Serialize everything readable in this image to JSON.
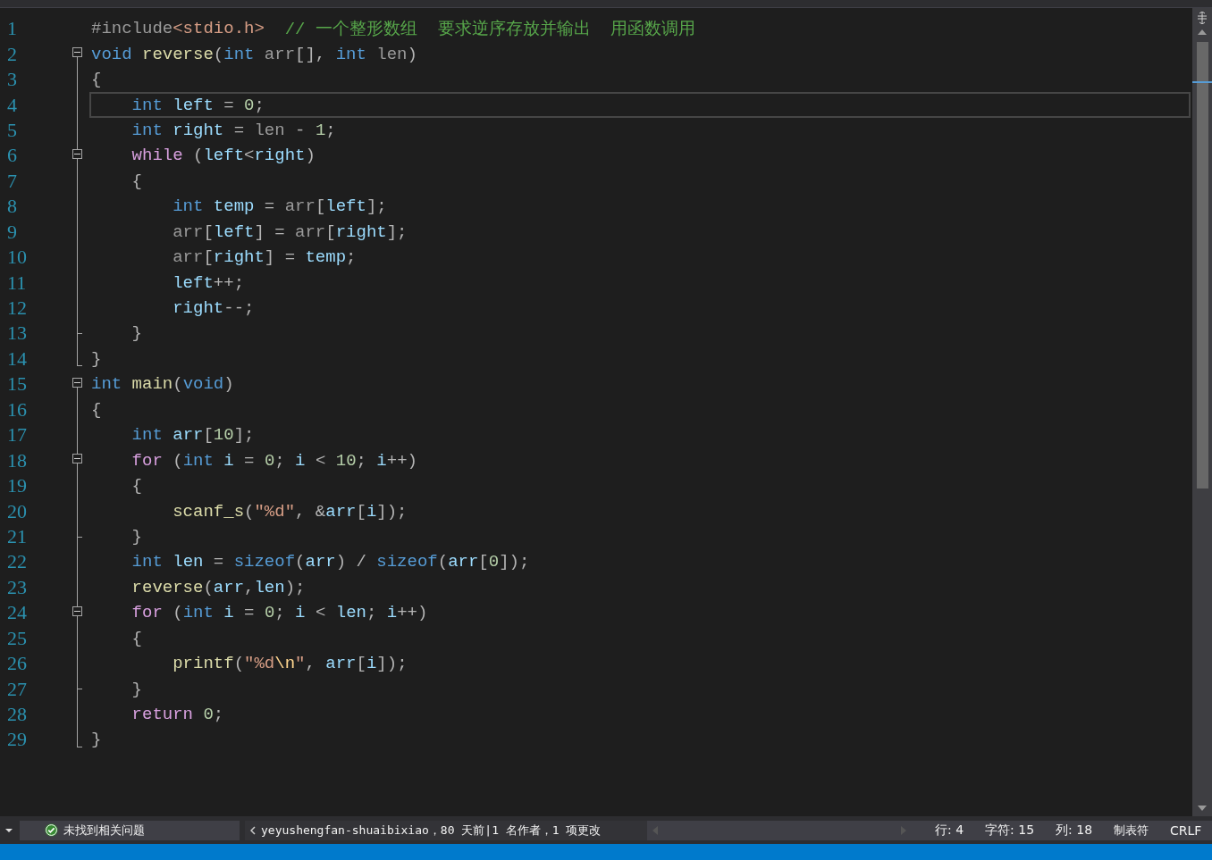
{
  "editor": {
    "lines": [
      {
        "number": "1",
        "kind": "none",
        "current": false,
        "tokens": [
          {
            "kind": "preproc",
            "text": "#include"
          },
          {
            "kind": "string",
            "text": "<stdio.h>"
          },
          {
            "kind": "comment",
            "text": "  // 一个整形数组  要求逆序存放并输出  用函数调用"
          }
        ]
      },
      {
        "number": "2",
        "kind": "open",
        "current": false,
        "tokens": [
          {
            "kind": "type",
            "text": "void"
          },
          {
            "kind": "func",
            "text": " reverse"
          },
          {
            "kind": "plain",
            "text": "("
          },
          {
            "kind": "type",
            "text": "int"
          },
          {
            "kind": "param",
            "text": " arr"
          },
          {
            "kind": "plain",
            "text": "[], "
          },
          {
            "kind": "type",
            "text": "int"
          },
          {
            "kind": "param",
            "text": " len"
          },
          {
            "kind": "plain",
            "text": ")"
          }
        ]
      },
      {
        "number": "3",
        "kind": "line",
        "current": false,
        "tokens": [
          {
            "kind": "plain",
            "text": "{"
          }
        ]
      },
      {
        "number": "4",
        "kind": "line",
        "current": true,
        "tokens": [
          {
            "kind": "type",
            "text": "    int"
          },
          {
            "kind": "local",
            "text": " left"
          },
          {
            "kind": "plain",
            "text": " = "
          },
          {
            "kind": "number",
            "text": "0"
          },
          {
            "kind": "plain",
            "text": ";"
          }
        ]
      },
      {
        "number": "5",
        "kind": "line",
        "current": false,
        "tokens": [
          {
            "kind": "type",
            "text": "    int"
          },
          {
            "kind": "local",
            "text": " right"
          },
          {
            "kind": "plain",
            "text": " = "
          },
          {
            "kind": "param",
            "text": "len"
          },
          {
            "kind": "plain",
            "text": " - "
          },
          {
            "kind": "number",
            "text": "1"
          },
          {
            "kind": "plain",
            "text": ";"
          }
        ]
      },
      {
        "number": "6",
        "kind": "open",
        "current": false,
        "tokens": [
          {
            "kind": "control",
            "text": "    while"
          },
          {
            "kind": "plain",
            "text": " ("
          },
          {
            "kind": "local",
            "text": "left"
          },
          {
            "kind": "plain",
            "text": "<"
          },
          {
            "kind": "local",
            "text": "right"
          },
          {
            "kind": "plain",
            "text": ")"
          }
        ]
      },
      {
        "number": "7",
        "kind": "line",
        "current": false,
        "tokens": [
          {
            "kind": "plain",
            "text": "    {"
          }
        ]
      },
      {
        "number": "8",
        "kind": "line",
        "current": false,
        "tokens": [
          {
            "kind": "type",
            "text": "        int"
          },
          {
            "kind": "local",
            "text": " temp"
          },
          {
            "kind": "plain",
            "text": " = "
          },
          {
            "kind": "param",
            "text": "arr"
          },
          {
            "kind": "plain",
            "text": "["
          },
          {
            "kind": "local",
            "text": "left"
          },
          {
            "kind": "plain",
            "text": "];"
          }
        ]
      },
      {
        "number": "9",
        "kind": "line",
        "current": false,
        "tokens": [
          {
            "kind": "param",
            "text": "        arr"
          },
          {
            "kind": "plain",
            "text": "["
          },
          {
            "kind": "local",
            "text": "left"
          },
          {
            "kind": "plain",
            "text": "] = "
          },
          {
            "kind": "param",
            "text": "arr"
          },
          {
            "kind": "plain",
            "text": "["
          },
          {
            "kind": "local",
            "text": "right"
          },
          {
            "kind": "plain",
            "text": "];"
          }
        ]
      },
      {
        "number": "10",
        "kind": "line",
        "current": false,
        "tokens": [
          {
            "kind": "param",
            "text": "        arr"
          },
          {
            "kind": "plain",
            "text": "["
          },
          {
            "kind": "local",
            "text": "right"
          },
          {
            "kind": "plain",
            "text": "] = "
          },
          {
            "kind": "local",
            "text": "temp"
          },
          {
            "kind": "plain",
            "text": ";"
          }
        ]
      },
      {
        "number": "11",
        "kind": "line",
        "current": false,
        "tokens": [
          {
            "kind": "local",
            "text": "        left"
          },
          {
            "kind": "plain",
            "text": "++;"
          }
        ]
      },
      {
        "number": "12",
        "kind": "line",
        "current": false,
        "tokens": [
          {
            "kind": "local",
            "text": "        right"
          },
          {
            "kind": "plain",
            "text": "--;"
          }
        ]
      },
      {
        "number": "13",
        "kind": "tick",
        "current": false,
        "tokens": [
          {
            "kind": "plain",
            "text": "    }"
          }
        ]
      },
      {
        "number": "14",
        "kind": "end",
        "current": false,
        "tokens": [
          {
            "kind": "plain",
            "text": "}"
          }
        ]
      },
      {
        "number": "15",
        "kind": "open",
        "current": false,
        "tokens": [
          {
            "kind": "type",
            "text": "int"
          },
          {
            "kind": "func",
            "text": " main"
          },
          {
            "kind": "plain",
            "text": "("
          },
          {
            "kind": "type",
            "text": "void"
          },
          {
            "kind": "plain",
            "text": ")"
          }
        ]
      },
      {
        "number": "16",
        "kind": "line",
        "current": false,
        "tokens": [
          {
            "kind": "plain",
            "text": "{"
          }
        ]
      },
      {
        "number": "17",
        "kind": "line",
        "current": false,
        "tokens": [
          {
            "kind": "type",
            "text": "    int"
          },
          {
            "kind": "local",
            "text": " arr"
          },
          {
            "kind": "plain",
            "text": "["
          },
          {
            "kind": "number",
            "text": "10"
          },
          {
            "kind": "plain",
            "text": "];"
          }
        ]
      },
      {
        "number": "18",
        "kind": "open",
        "current": false,
        "tokens": [
          {
            "kind": "control",
            "text": "    for"
          },
          {
            "kind": "plain",
            "text": " ("
          },
          {
            "kind": "type",
            "text": "int"
          },
          {
            "kind": "local",
            "text": " i"
          },
          {
            "kind": "plain",
            "text": " = "
          },
          {
            "kind": "number",
            "text": "0"
          },
          {
            "kind": "plain",
            "text": "; "
          },
          {
            "kind": "local",
            "text": "i"
          },
          {
            "kind": "plain",
            "text": " < "
          },
          {
            "kind": "number",
            "text": "10"
          },
          {
            "kind": "plain",
            "text": "; "
          },
          {
            "kind": "local",
            "text": "i"
          },
          {
            "kind": "plain",
            "text": "++)"
          }
        ]
      },
      {
        "number": "19",
        "kind": "line",
        "current": false,
        "tokens": [
          {
            "kind": "plain",
            "text": "    {"
          }
        ]
      },
      {
        "number": "20",
        "kind": "line",
        "current": false,
        "tokens": [
          {
            "kind": "func",
            "text": "        scanf_s"
          },
          {
            "kind": "plain",
            "text": "("
          },
          {
            "kind": "string",
            "text": "\"%d\""
          },
          {
            "kind": "plain",
            "text": ", &"
          },
          {
            "kind": "local",
            "text": "arr"
          },
          {
            "kind": "plain",
            "text": "["
          },
          {
            "kind": "local",
            "text": "i"
          },
          {
            "kind": "plain",
            "text": "]);"
          }
        ]
      },
      {
        "number": "21",
        "kind": "tick",
        "current": false,
        "tokens": [
          {
            "kind": "plain",
            "text": "    }"
          }
        ]
      },
      {
        "number": "22",
        "kind": "line",
        "current": false,
        "tokens": [
          {
            "kind": "type",
            "text": "    int"
          },
          {
            "kind": "local",
            "text": " len"
          },
          {
            "kind": "plain",
            "text": " = "
          },
          {
            "kind": "type",
            "text": "sizeof"
          },
          {
            "kind": "plain",
            "text": "("
          },
          {
            "kind": "local",
            "text": "arr"
          },
          {
            "kind": "plain",
            "text": ") / "
          },
          {
            "kind": "type",
            "text": "sizeof"
          },
          {
            "kind": "plain",
            "text": "("
          },
          {
            "kind": "local",
            "text": "arr"
          },
          {
            "kind": "plain",
            "text": "["
          },
          {
            "kind": "number",
            "text": "0"
          },
          {
            "kind": "plain",
            "text": "]);"
          }
        ]
      },
      {
        "number": "23",
        "kind": "line",
        "current": false,
        "tokens": [
          {
            "kind": "func",
            "text": "    reverse"
          },
          {
            "kind": "plain",
            "text": "("
          },
          {
            "kind": "local",
            "text": "arr"
          },
          {
            "kind": "plain",
            "text": ","
          },
          {
            "kind": "local",
            "text": "len"
          },
          {
            "kind": "plain",
            "text": ");"
          }
        ]
      },
      {
        "number": "24",
        "kind": "open",
        "current": false,
        "tokens": [
          {
            "kind": "control",
            "text": "    for"
          },
          {
            "kind": "plain",
            "text": " ("
          },
          {
            "kind": "type",
            "text": "int"
          },
          {
            "kind": "local",
            "text": " i"
          },
          {
            "kind": "plain",
            "text": " = "
          },
          {
            "kind": "number",
            "text": "0"
          },
          {
            "kind": "plain",
            "text": "; "
          },
          {
            "kind": "local",
            "text": "i"
          },
          {
            "kind": "plain",
            "text": " < "
          },
          {
            "kind": "local",
            "text": "len"
          },
          {
            "kind": "plain",
            "text": "; "
          },
          {
            "kind": "local",
            "text": "i"
          },
          {
            "kind": "plain",
            "text": "++)"
          }
        ]
      },
      {
        "number": "25",
        "kind": "line",
        "current": false,
        "tokens": [
          {
            "kind": "plain",
            "text": "    {"
          }
        ]
      },
      {
        "number": "26",
        "kind": "line",
        "current": false,
        "tokens": [
          {
            "kind": "func",
            "text": "        printf"
          },
          {
            "kind": "plain",
            "text": "("
          },
          {
            "kind": "string",
            "text": "\"%d"
          },
          {
            "kind": "escape",
            "text": "\\n"
          },
          {
            "kind": "string",
            "text": "\""
          },
          {
            "kind": "plain",
            "text": ", "
          },
          {
            "kind": "local",
            "text": "arr"
          },
          {
            "kind": "plain",
            "text": "["
          },
          {
            "kind": "local",
            "text": "i"
          },
          {
            "kind": "plain",
            "text": "]);"
          }
        ]
      },
      {
        "number": "27",
        "kind": "tick",
        "current": false,
        "tokens": [
          {
            "kind": "plain",
            "text": "    }"
          }
        ]
      },
      {
        "number": "28",
        "kind": "line",
        "current": false,
        "tokens": [
          {
            "kind": "control",
            "text": "    return "
          },
          {
            "kind": "number",
            "text": "0"
          },
          {
            "kind": "plain",
            "text": ";"
          }
        ]
      },
      {
        "number": "29",
        "kind": "end",
        "current": false,
        "tokens": [
          {
            "kind": "plain",
            "text": "}"
          }
        ]
      }
    ]
  },
  "status_bar": {
    "issues": "未找到相关问题",
    "git_info": "yeyushengfan-shuaibixiao，80 天前|1 名作者，1 项更改",
    "line": "行: 4",
    "char": "字符: 15",
    "column": "列: 18",
    "indent": "制表符",
    "line_ending": "CRLF"
  }
}
